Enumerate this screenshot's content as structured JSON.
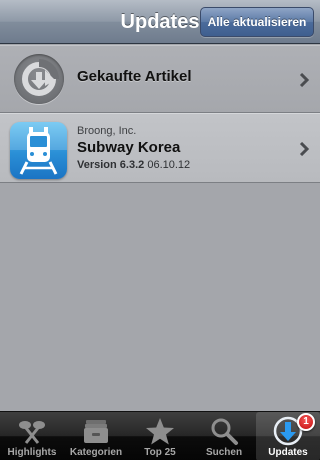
{
  "navbar": {
    "title": "Updates",
    "update_all_label": "Alle aktualisieren"
  },
  "purchased": {
    "label": "Gekaufte Artikel",
    "icon": "download-history-icon"
  },
  "app": {
    "developer": "Broong, Inc.",
    "name": "Subway Korea",
    "version_label": "Version 6.3.2",
    "date": "06.10.12",
    "icon": "subway-train-icon"
  },
  "tabs": [
    {
      "label": "Highlights",
      "icon": "highlights-icon"
    },
    {
      "label": "Kategorien",
      "icon": "categories-icon"
    },
    {
      "label": "Top 25",
      "icon": "star-icon"
    },
    {
      "label": "Suchen",
      "icon": "search-icon"
    },
    {
      "label": "Updates",
      "icon": "updates-icon",
      "badge": "1",
      "active": true
    }
  ],
  "colors": {
    "accent": "#4b6b9b",
    "badge": "#d91818",
    "app_icon": "#2a8fd6"
  }
}
